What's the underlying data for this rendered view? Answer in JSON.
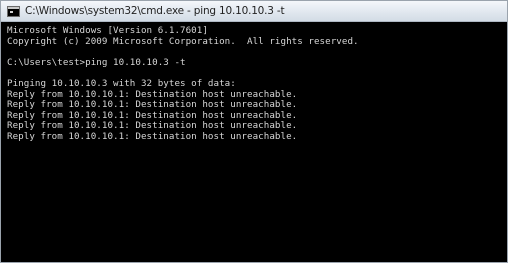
{
  "window": {
    "title": "C:\\Windows\\system32\\cmd.exe - ping 10.10.10.3 -t"
  },
  "console": {
    "header_lines": [
      "Microsoft Windows [Version 6.1.7601]",
      "Copyright (c) 2009 Microsoft Corporation.  All rights reserved."
    ],
    "command_line": "C:\\Users\\test>ping 10.10.10.3 -t",
    "output_lines": [
      "Pinging 10.10.10.3 with 32 bytes of data:",
      "Reply from 10.10.10.1: Destination host unreachable.",
      "Reply from 10.10.10.1: Destination host unreachable.",
      "Reply from 10.10.10.1: Destination host unreachable.",
      "Reply from 10.10.10.1: Destination host unreachable.",
      "Reply from 10.10.10.1: Destination host unreachable."
    ]
  },
  "colors": {
    "console_background": "#000000",
    "console_text": "#d6d6d6"
  },
  "icons": {
    "window_icon": "cmd-console-icon"
  }
}
